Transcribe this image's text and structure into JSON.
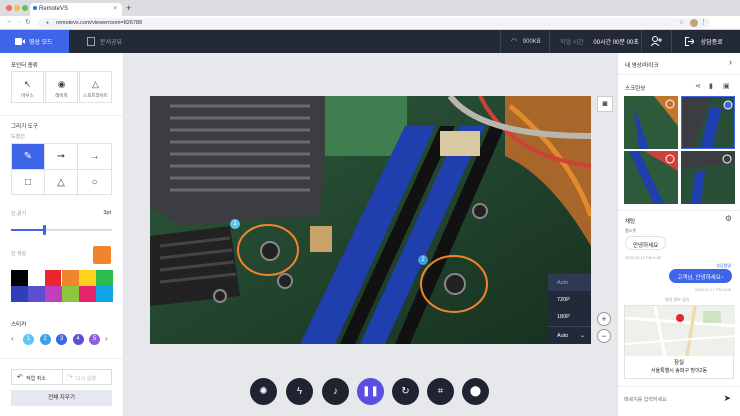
{
  "browser": {
    "tab_title": "RemoteVS",
    "tab_close": "×",
    "new_tab": "+",
    "url": "remotevs.com/viewerroom=826788",
    "nav": {
      "back": "←",
      "forward": "→",
      "reload": "↻"
    }
  },
  "appbar": {
    "mode_video": "영상 모드",
    "mode_doc": "문서공유",
    "bitrate": "900KB",
    "elapsed_label": "작업 시간",
    "elapsed_value": "00시간 00분 00초",
    "end_label": "상담종료",
    "accent": "#3e64e8"
  },
  "left": {
    "pointer_title": "포인터 종류",
    "pointer_tools": [
      {
        "label": "마우스",
        "icon": "cursor-icon"
      },
      {
        "label": "레이저",
        "icon": "laser-icon"
      },
      {
        "label": "스포트라이트",
        "icon": "spotlight-icon"
      }
    ],
    "draw_title": "그리기 도구",
    "shape_label": "도형선",
    "thickness_label": "선 굵기",
    "thickness_value": "3pt",
    "thickness_level": 0.33,
    "color_label": "선 색상",
    "selected_color": "#f0852d",
    "palette": [
      "#000000",
      "#ffffff",
      "#e8262b",
      "#f0852d",
      "#ffd21f",
      "#2cbc4e",
      "#2f3fb8",
      "#5a4fcf",
      "#bf3fbf",
      "#8cc63f",
      "#e8246f",
      "#11a5e8"
    ],
    "sticker_title": "스티커",
    "stickers": [
      "1",
      "2",
      "3",
      "4",
      "5"
    ],
    "sticker_colors": [
      "#5ec4f0",
      "#3e9ee8",
      "#3e64e8",
      "#5a4fcf",
      "#8b5fd9"
    ],
    "undo": "작업 취소",
    "redo": "다시 실행",
    "clear": "전체 지우기"
  },
  "video": {
    "quality_options": [
      "Auto",
      "720P",
      "180P"
    ],
    "quality_selected": "Auto",
    "markers": [
      "1",
      "2"
    ]
  },
  "right": {
    "title": "내 영상/마이크",
    "screenshot_title": "스크린샷",
    "chat_title": "채팅",
    "agent_name": "웹소켓",
    "msg_in": "안녕하세요",
    "msg_in_time": "2020.02.17 PM 5:05",
    "me_name": "상담원명",
    "msg_out": "고객님, 안녕하세요~",
    "msg_out_time": "2020.02.17 PM 5:05",
    "location_label": "위치 정보 공유",
    "location_name": "잠실",
    "location_sub": "서울특별시 송파구 방이2동",
    "chat_placeholder": "메세지를 입력하세요"
  }
}
